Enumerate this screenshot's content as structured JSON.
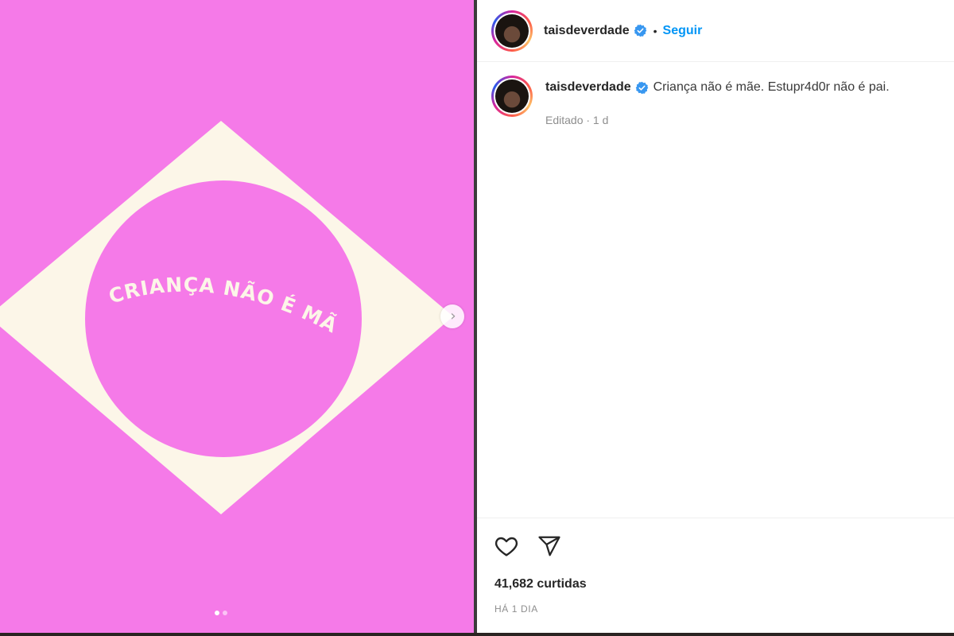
{
  "header": {
    "username": "taisdeverdade",
    "separator": "•",
    "follow_label": "Seguir"
  },
  "post": {
    "artwork_text": "CRIANÇA NÃO É MÃE",
    "next_glyph": "›",
    "carousel": {
      "slides": 2,
      "active": 0
    }
  },
  "caption": {
    "username": "taisdeverdade",
    "text": "Criança não é mãe. Estupr4d0r não é pai.",
    "meta": "Editado · 1 d"
  },
  "footer": {
    "likes": "41,682 curtidas",
    "timestamp": "HÁ 1 DIA"
  },
  "colors": {
    "media_background": "#f57ae8",
    "diamond": "#fcf6e8",
    "link_blue": "#0095f6",
    "verified_blue": "#3897f0"
  },
  "icons": {
    "like": "heart-icon",
    "share": "paper-plane-icon",
    "verified": "verified-badge-icon",
    "next": "chevron-right-icon"
  }
}
